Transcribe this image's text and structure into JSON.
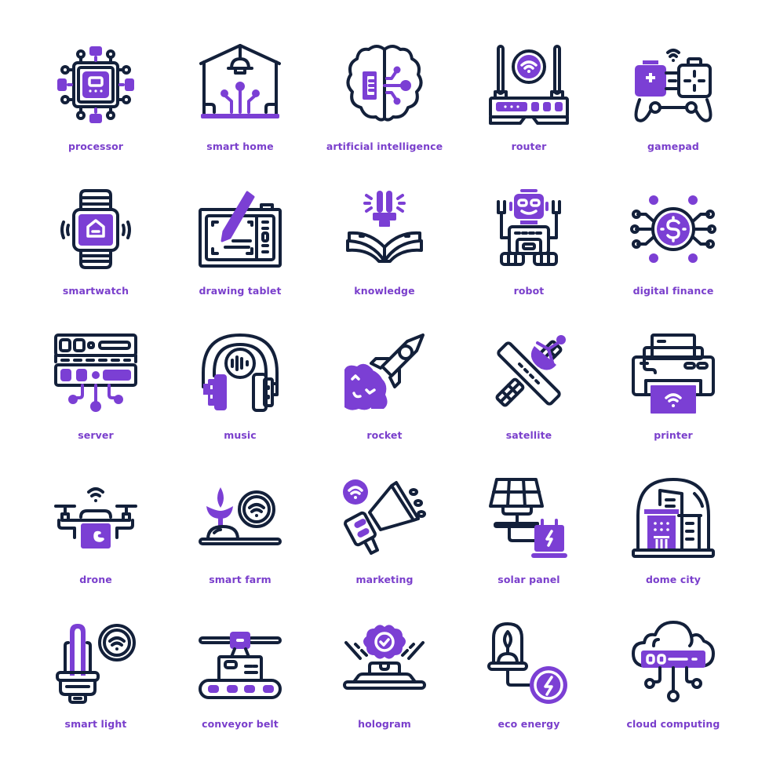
{
  "colors": {
    "accent": "#7b3fd4",
    "outline": "#13203a",
    "label": "#7a3fcc",
    "background": "#ffffff"
  },
  "icons": [
    {
      "label": "processor",
      "icon": "processor-icon"
    },
    {
      "label": "smart home",
      "icon": "smart-home-icon"
    },
    {
      "label": "artificial intelligence",
      "icon": "artificial-intelligence-icon"
    },
    {
      "label": "router",
      "icon": "router-icon"
    },
    {
      "label": "gamepad",
      "icon": "gamepad-icon"
    },
    {
      "label": "smartwatch",
      "icon": "smartwatch-icon"
    },
    {
      "label": "drawing tablet",
      "icon": "drawing-tablet-icon"
    },
    {
      "label": "knowledge",
      "icon": "knowledge-icon"
    },
    {
      "label": "robot",
      "icon": "robot-icon"
    },
    {
      "label": "digital finance",
      "icon": "digital-finance-icon"
    },
    {
      "label": "server",
      "icon": "server-icon"
    },
    {
      "label": "music",
      "icon": "music-icon"
    },
    {
      "label": "rocket",
      "icon": "rocket-icon"
    },
    {
      "label": "satellite",
      "icon": "satellite-icon"
    },
    {
      "label": "printer",
      "icon": "printer-icon"
    },
    {
      "label": "drone",
      "icon": "drone-icon"
    },
    {
      "label": "smart farm",
      "icon": "smart-farm-icon"
    },
    {
      "label": "marketing",
      "icon": "marketing-icon"
    },
    {
      "label": "solar panel",
      "icon": "solar-panel-icon"
    },
    {
      "label": "dome city",
      "icon": "dome-city-icon"
    },
    {
      "label": "smart light",
      "icon": "smart-light-icon"
    },
    {
      "label": "conveyor belt",
      "icon": "conveyor-belt-icon"
    },
    {
      "label": "hologram",
      "icon": "hologram-icon"
    },
    {
      "label": "eco energy",
      "icon": "eco-energy-icon"
    },
    {
      "label": "cloud computing",
      "icon": "cloud-computing-icon"
    }
  ]
}
